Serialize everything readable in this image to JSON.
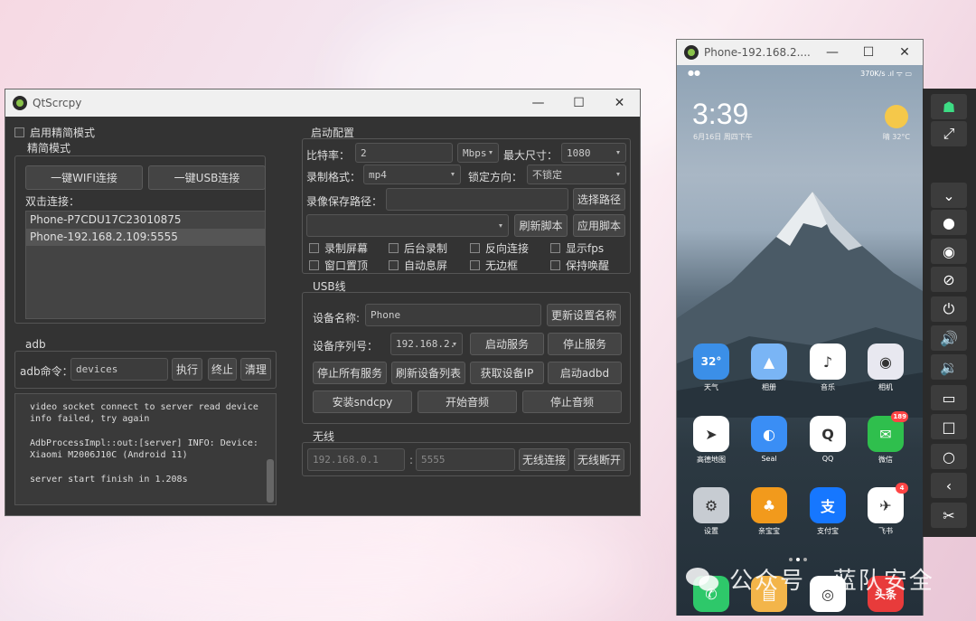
{
  "qt": {
    "title": "QtScrcpy",
    "simple_mode_checkbox": "启用精简模式",
    "simple_group": {
      "title": "精简模式",
      "wifi_button": "一键WIFI连接",
      "usb_button": "一键USB连接",
      "double_click_label": "双击连接：",
      "devices": [
        "Phone-P7CDU17C23010875",
        "Phone-192.168.2.109:5555"
      ]
    },
    "adb": {
      "title": "adb",
      "cmd_label": "adb命令：",
      "cmd_value": "devices",
      "execute": "执行",
      "stop": "终止",
      "clear": "清理"
    },
    "log": [
      "video socket connect to server read device info failed, try again",
      "AdbProcessImpl::out:[server] INFO: Device: Xiaomi M2006J10C (Android 11)",
      "server start finish in 1.208s"
    ],
    "start_config": {
      "title": "启动配置",
      "bitrate_label": "比特率：",
      "bitrate_value": "2",
      "bitrate_unit": "Mbps",
      "max_size_label": "最大尺寸：",
      "max_size_value": "1080",
      "record_format_label": "录制格式：",
      "record_format_value": "mp4",
      "lock_dir_label": "锁定方向：",
      "lock_dir_value": "不锁定",
      "record_path_label": "录像保存路径：",
      "record_path_value": "",
      "choose_path": "选择路径",
      "refresh_script": "刷新脚本",
      "apply_script": "应用脚本",
      "options": [
        "录制屏幕",
        "后台录制",
        "反向连接",
        "显示fps",
        "窗口置顶",
        "自动息屏",
        "无边框",
        "保持唤醒"
      ]
    },
    "usb": {
      "title": "USB线",
      "device_name_label": "设备名称:",
      "device_name_value": "Phone",
      "update_name": "更新设置名称",
      "serial_label": "设备序列号：",
      "serial_value": "192.168.2.",
      "start_service": "启动服务",
      "stop_service": "停止服务",
      "stop_all": "停止所有服务",
      "refresh_devices": "刷新设备列表",
      "get_ip": "获取设备IP",
      "start_adbd": "启动adbd",
      "install_sndcpy": "安装sndcpy",
      "start_audio": "开始音频",
      "stop_audio": "停止音频"
    },
    "wireless": {
      "title": "无线",
      "ip_placeholder": "192.168.0.1",
      "port_placeholder": "5555",
      "connect": "无线连接",
      "disconnect": "无线断开"
    }
  },
  "phone_window": {
    "title": "Phone-192.168.2....",
    "status_right": "370K/s .ıl ᯤ ▭",
    "time": "3:39",
    "date": "6月16日 周四下午",
    "weather": "晴 32°C",
    "apps": [
      {
        "name": "天气",
        "glyph": "32°",
        "color": "#3b8fe8"
      },
      {
        "name": "相册",
        "glyph": "▲",
        "color": "#7ab5f5"
      },
      {
        "name": "音乐",
        "glyph": "♪",
        "color": "#ffffff"
      },
      {
        "name": "相机",
        "glyph": "◉",
        "color": "#e8e8f0"
      },
      {
        "name": "高德地图",
        "glyph": "➤",
        "color": "#ffffff"
      },
      {
        "name": "Seal",
        "glyph": "◐",
        "color": "#3a8ef5"
      },
      {
        "name": "QQ",
        "glyph": "Q",
        "color": "#ffffff"
      },
      {
        "name": "微信",
        "glyph": "✉",
        "color": "#2fbf4d",
        "badge": "189"
      },
      {
        "name": "设置",
        "glyph": "⚙",
        "color": "#c7ccd2"
      },
      {
        "name": "亲宝宝",
        "glyph": "♣",
        "color": "#f29a1c"
      },
      {
        "name": "支付宝",
        "glyph": "支",
        "color": "#1677ff"
      },
      {
        "name": "飞书",
        "glyph": "✈",
        "color": "#ffffff",
        "badge": "4"
      },
      {
        "name": "",
        "glyph": "✆",
        "color": "#2ec86a"
      },
      {
        "name": "",
        "glyph": "▤",
        "color": "#f3b54a"
      },
      {
        "name": "",
        "glyph": "◎",
        "color": "#ffffff"
      },
      {
        "name": "",
        "glyph": "头条",
        "color": "#e83b3b"
      }
    ]
  },
  "toolbar": {
    "buttons": [
      {
        "icon": "android-icon",
        "glyph": "☗"
      },
      {
        "icon": "fullscreen-icon",
        "glyph": "⤢"
      },
      {
        "icon": "expand-notification-icon",
        "glyph": "⌄"
      },
      {
        "icon": "touch-show-icon",
        "glyph": "●"
      },
      {
        "icon": "screen-on-icon",
        "glyph": "◉"
      },
      {
        "icon": "screen-off-icon",
        "glyph": "⊘"
      },
      {
        "icon": "power-icon",
        "glyph": "⏻"
      },
      {
        "icon": "volume-up-icon",
        "glyph": "🔊"
      },
      {
        "icon": "volume-down-icon",
        "glyph": "🔉"
      },
      {
        "icon": "app-switch-icon",
        "glyph": "▭"
      },
      {
        "icon": "menu-icon",
        "glyph": "□"
      },
      {
        "icon": "home-icon",
        "glyph": "○"
      },
      {
        "icon": "back-icon",
        "glyph": "‹"
      },
      {
        "icon": "screenshot-icon",
        "glyph": "✂"
      }
    ]
  },
  "watermark": "公众号 · 蓝队安全"
}
